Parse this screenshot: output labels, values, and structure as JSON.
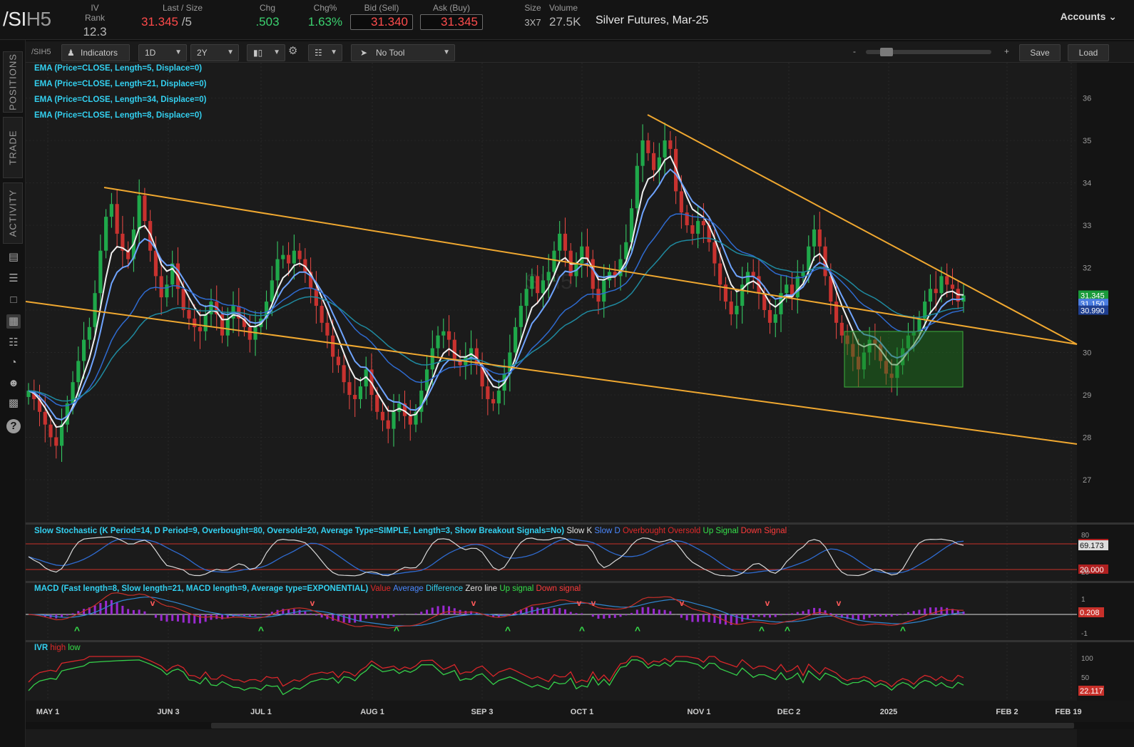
{
  "header": {
    "symbol_main": "/SI",
    "symbol_suffix": "H5",
    "iv_rank_label": "IV Rank",
    "iv_rank": "12.3",
    "last_label": "Last / Size",
    "last": "31.345",
    "size": "/5",
    "chg_label": "Chg",
    "chg": ".503",
    "chg_pct_label": "Chg%",
    "chg_pct": "1.63%",
    "bid_label": "Bid (Sell)",
    "bid": "31.340",
    "ask_label": "Ask (Buy)",
    "ask": "31.345",
    "size_label": "Size",
    "size_val": "3X7",
    "volume_label": "Volume",
    "volume": "27.5K",
    "description": "Silver Futures, Mar-25",
    "accounts": "Accounts"
  },
  "rail": {
    "tabs": [
      "POSITIONS",
      "TRADE",
      "ACTIVITY"
    ],
    "icons": [
      "chart-icon",
      "list-icon",
      "clipboard-icon",
      "grid-chart-icon",
      "grid-icon",
      "gauge-icon",
      "users-icon",
      "calendar-icon",
      "help-icon"
    ]
  },
  "toolbar": {
    "symbol": "/SIH5",
    "indicators": "Indicators",
    "aggregation": "1D",
    "range": "2Y",
    "tool": "No Tool",
    "zoom_minus": "-",
    "zoom_plus": "+",
    "save": "Save",
    "load": "Load"
  },
  "watermark": "SIH5",
  "studies": {
    "ema": [
      "EMA (Price=CLOSE, Length=5, Displace=0)",
      "EMA (Price=CLOSE, Length=21, Displace=0)",
      "EMA (Price=CLOSE, Length=34, Displace=0)",
      "EMA (Price=CLOSE, Length=8, Displace=0)"
    ],
    "stoch": {
      "label": "Slow Stochastic (K Period=14, D Period=9, Overbought=80, Oversold=20, Average Type=SIMPLE, Length=3, Show Breakout Signals=No)",
      "legend": [
        "Slow K",
        "Slow D",
        "Overbought",
        "Oversold",
        "Up Signal",
        "Down Signal"
      ],
      "k_value": "69.173",
      "oversold_value": "20.000",
      "ob_value": "80.000"
    },
    "macd": {
      "label": "MACD (Fast length=8, Slow length=21, MACD length=9, Average type=EXPONENTIAL)",
      "legend": [
        "Value",
        "Average",
        "Difference",
        "Zero line",
        "Up signal",
        "Down signal"
      ],
      "value": "0.208"
    },
    "ivr": {
      "label": "IVR",
      "legend": [
        "high",
        "low"
      ],
      "value": "22.117"
    }
  },
  "price_labels": {
    "last": "31.345",
    "ema_a": "31.150",
    "ema_b": "30.990"
  },
  "chart_data": {
    "type": "candlestick",
    "price_axis": {
      "min": 27,
      "max": 36,
      "ticks": [
        27,
        28,
        29,
        30,
        31,
        32,
        33,
        34,
        35,
        36
      ]
    },
    "x_ticks": [
      "MAY 1",
      "JUN 3",
      "JUL 1",
      "AUG 1",
      "SEP 3",
      "OCT 1",
      "NOV 1",
      "DEC 2",
      "2025",
      "FEB 2",
      "FEB 19"
    ],
    "stoch_ticks": [
      "80",
      "20"
    ],
    "macd_ticks": [
      "1",
      "-1"
    ],
    "ivr_ticks": [
      "100",
      "50"
    ],
    "closes": [
      29.1,
      28.9,
      28.6,
      28.3,
      28.0,
      27.8,
      28.3,
      28.8,
      29.3,
      29.8,
      30.3,
      30.6,
      31.4,
      32.4,
      33.2,
      33.5,
      32.8,
      32.4,
      32.2,
      32.9,
      33.7,
      33.1,
      32.4,
      31.8,
      31.3,
      31.6,
      32.1,
      31.5,
      31.0,
      30.8,
      30.6,
      30.5,
      30.9,
      31.2,
      30.9,
      30.4,
      30.8,
      31.1,
      30.8,
      30.6,
      30.3,
      30.6,
      30.8,
      31.2,
      31.7,
      32.2,
      32.3,
      32.1,
      32.4,
      32.2,
      31.9,
      31.5,
      31.1,
      30.7,
      30.4,
      29.9,
      29.7,
      29.3,
      29.0,
      28.9,
      29.2,
      29.6,
      29.0,
      28.6,
      28.4,
      28.2,
      28.6,
      28.8,
      28.5,
      28.3,
      28.6,
      29.1,
      29.6,
      30.1,
      30.4,
      30.5,
      30.3,
      29.8,
      29.7,
      29.9,
      30.1,
      29.7,
      29.2,
      28.9,
      28.8,
      29.1,
      29.5,
      30.0,
      30.6,
      31.1,
      31.5,
      31.8,
      31.4,
      31.7,
      31.9,
      32.4,
      32.8,
      32.4,
      31.8,
      32.1,
      32.5,
      32.2,
      31.5,
      31.2,
      31.7,
      31.9,
      31.8,
      32.2,
      32.6,
      33.4,
      34.4,
      35.0,
      34.7,
      34.3,
      34.6,
      35.0,
      34.8,
      33.8,
      33.3,
      33.0,
      32.8,
      33.1,
      33.0,
      32.6,
      32.1,
      31.6,
      31.2,
      30.9,
      31.1,
      31.6,
      31.9,
      31.8,
      31.4,
      31.0,
      30.7,
      30.9,
      31.4,
      31.6,
      31.3,
      31.8,
      31.9,
      32.5,
      32.9,
      32.5,
      31.8,
      31.2,
      30.7,
      30.4,
      30.2,
      29.9,
      29.6,
      30.0,
      30.3,
      30.2,
      29.8,
      29.5,
      29.4,
      29.7,
      30.1,
      30.4,
      30.5,
      30.8,
      31.2,
      31.5,
      31.4,
      31.8,
      31.6,
      31.5,
      31.2,
      31.345
    ]
  }
}
